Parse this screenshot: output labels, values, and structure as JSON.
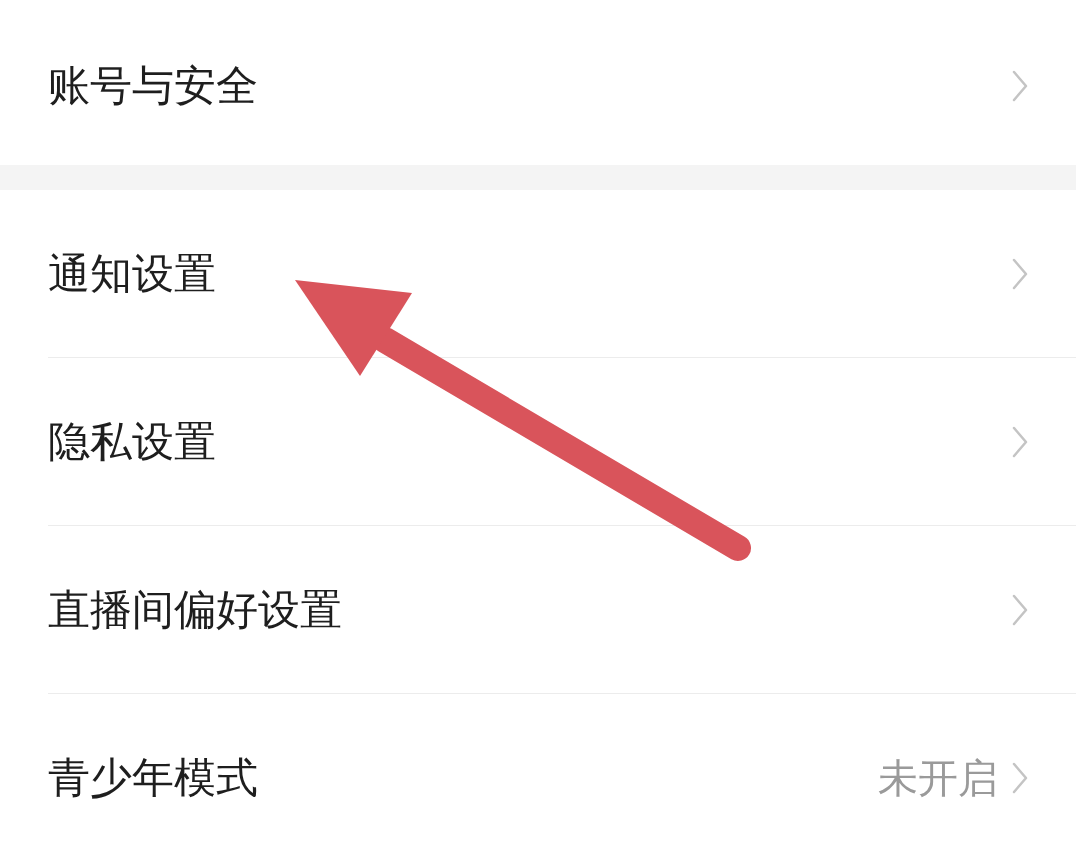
{
  "groups": [
    {
      "items": [
        {
          "label": "账号与安全"
        }
      ]
    },
    {
      "items": [
        {
          "label": "通知设置"
        },
        {
          "label": "隐私设置"
        },
        {
          "label": "直播间偏好设置"
        },
        {
          "label": "青少年模式",
          "value": "未开启"
        }
      ]
    }
  ]
}
